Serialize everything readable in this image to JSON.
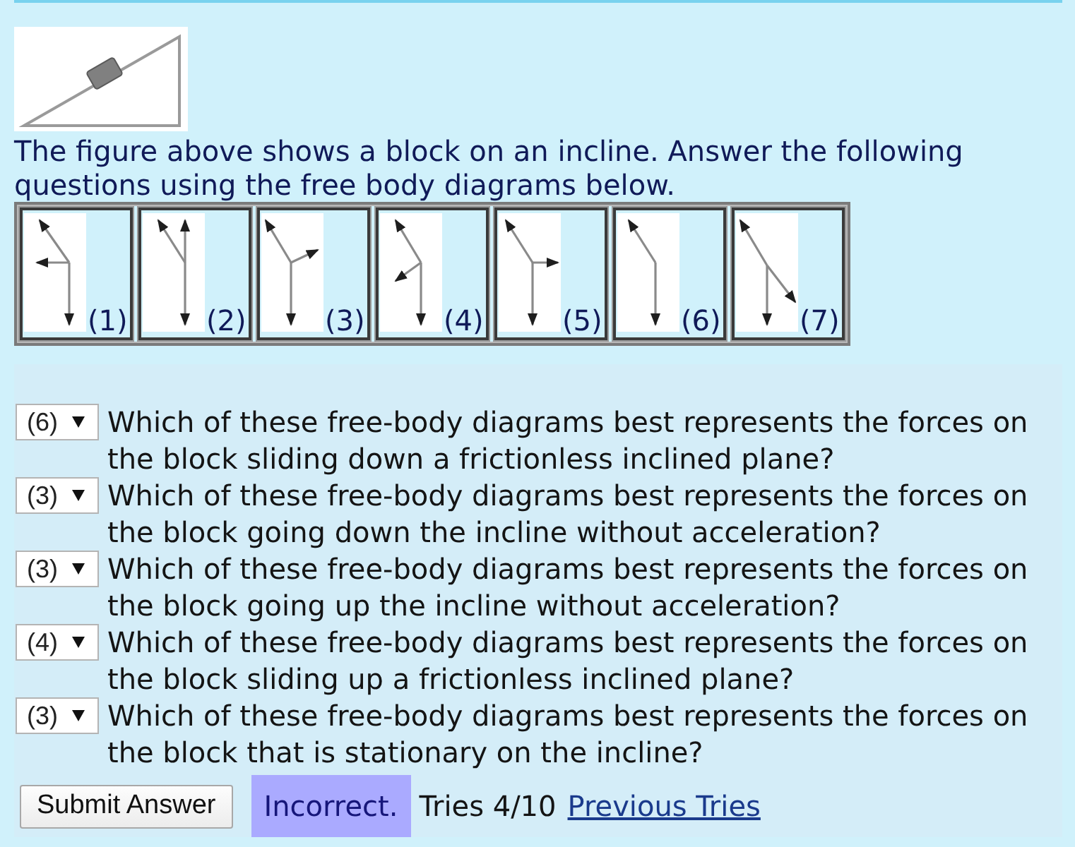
{
  "figure": {
    "caption": "The figure above shows a block on an incline. Answer the following questions using the free body diagrams below."
  },
  "diagrams": [
    {
      "label": "(1)"
    },
    {
      "label": "(2)"
    },
    {
      "label": "(3)"
    },
    {
      "label": "(4)"
    },
    {
      "label": "(5)"
    },
    {
      "label": "(6)"
    },
    {
      "label": "(7)"
    }
  ],
  "questions": [
    {
      "answer": "(6)",
      "text": "Which of these free-body diagrams best represents the forces on the block sliding down a frictionless inclined plane?"
    },
    {
      "answer": "(3)",
      "text": "Which of these free-body diagrams best represents the forces on the block going down the incline without acceleration?"
    },
    {
      "answer": "(3)",
      "text": "Which of these free-body diagrams best represents the forces on the block going up the incline without acceleration?"
    },
    {
      "answer": "(4)",
      "text": "Which of these free-body diagrams best represents the forces on the block sliding up a frictionless inclined plane?"
    },
    {
      "answer": "(3)",
      "text": "Which of these free-body diagrams best represents the forces on the block that is stationary on the incline?"
    }
  ],
  "submit_button": "Submit Answer",
  "result": {
    "status": "Incorrect.",
    "correct": false,
    "tries": "Tries 4/10",
    "link": "Previous Tries"
  }
}
